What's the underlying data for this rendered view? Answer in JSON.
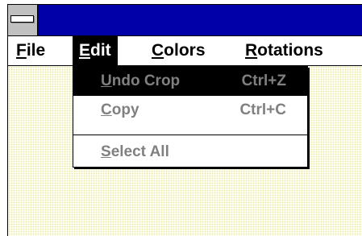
{
  "menubar": {
    "items": [
      {
        "label": "File",
        "mnemonic": "F"
      },
      {
        "label": "Edit",
        "mnemonic": "E"
      },
      {
        "label": "Colors",
        "mnemonic": "C"
      },
      {
        "label": "Rotations",
        "mnemonic": "R"
      }
    ],
    "active": "Edit"
  },
  "edit_menu": {
    "items": [
      {
        "label": "Undo Crop",
        "shortcut": "Ctrl+Z",
        "enabled": false,
        "highlighted": true
      },
      {
        "label": "Copy",
        "shortcut": "Ctrl+C",
        "enabled": false,
        "highlighted": false
      },
      {
        "label": "Select All",
        "shortcut": "",
        "enabled": false,
        "highlighted": false
      }
    ]
  },
  "colors": {
    "titlebar": "#0000a8",
    "client_background": "#fffff0",
    "disabled_text": "#808080"
  }
}
